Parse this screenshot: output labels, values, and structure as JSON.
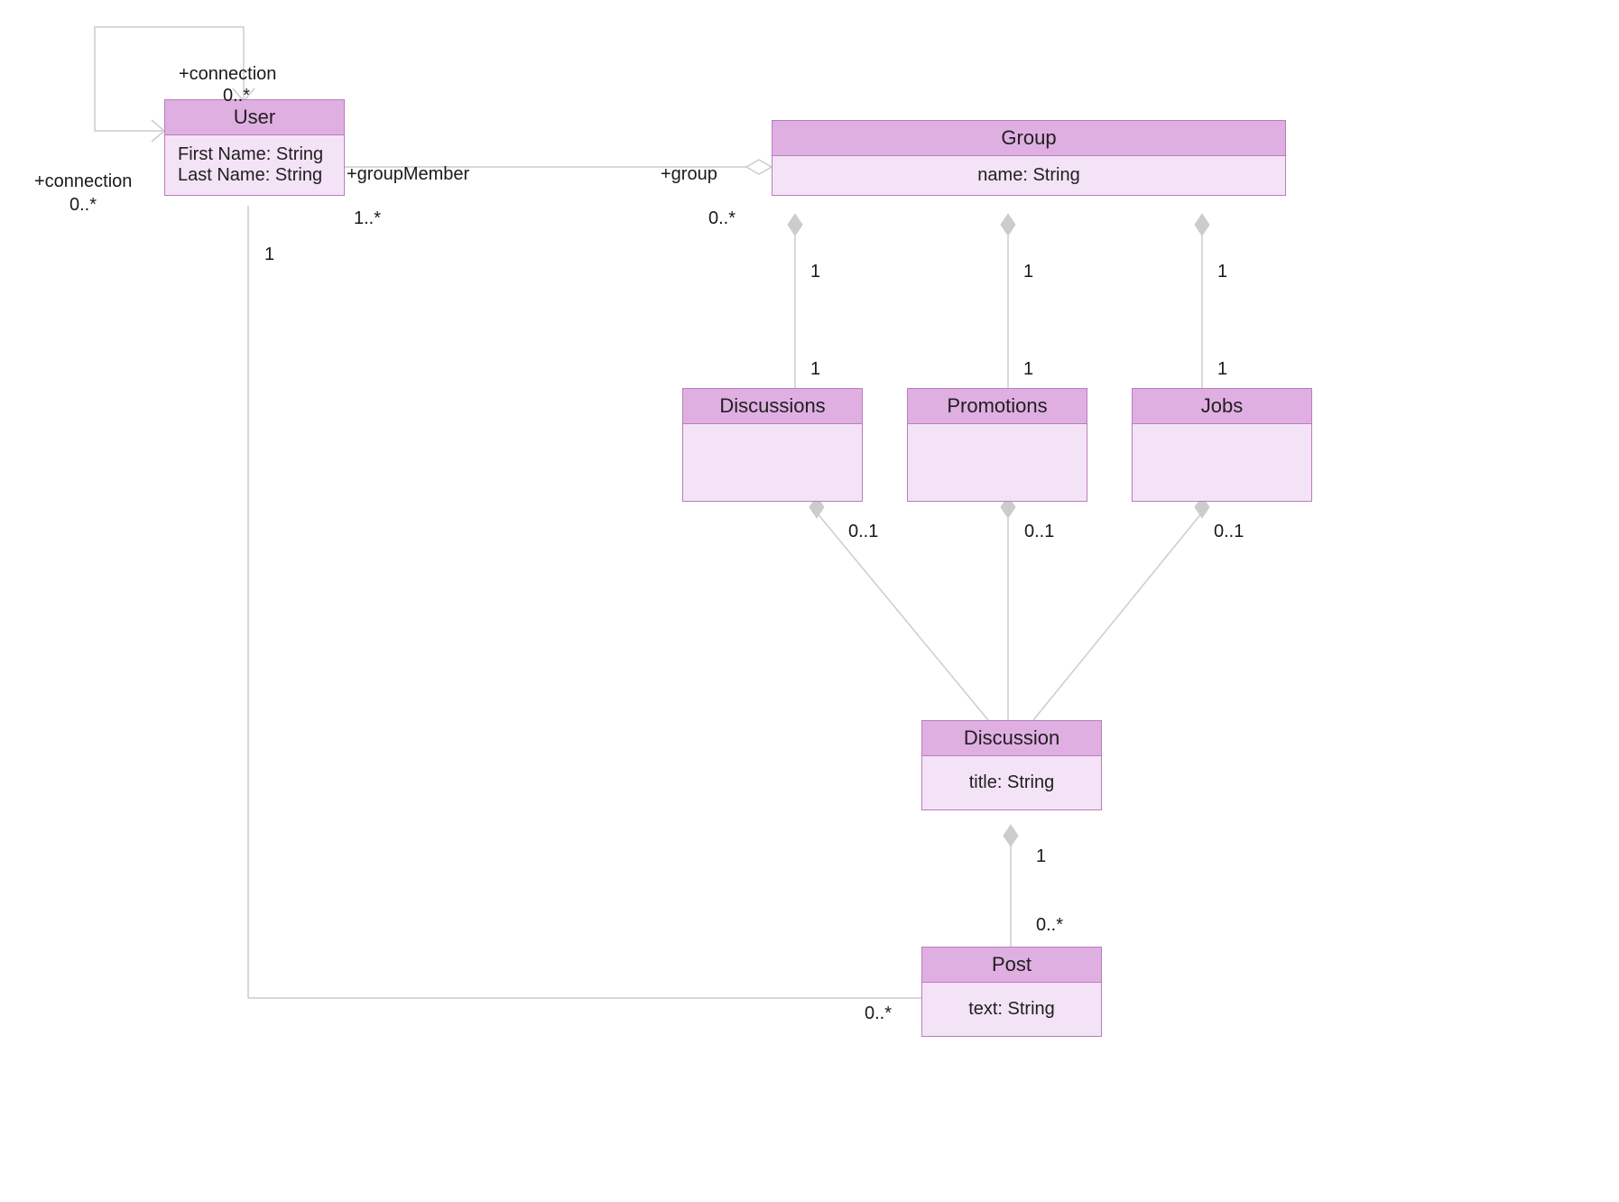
{
  "classes": {
    "user": {
      "name": "User",
      "attrs": [
        "First Name: String",
        "Last Name: String"
      ]
    },
    "group": {
      "name": "Group",
      "attrs": [
        "name: String"
      ]
    },
    "discussions": {
      "name": "Discussions",
      "attrs": []
    },
    "promotions": {
      "name": "Promotions",
      "attrs": []
    },
    "jobs": {
      "name": "Jobs",
      "attrs": []
    },
    "discussion": {
      "name": "Discussion",
      "attrs": [
        "title: String"
      ]
    },
    "post": {
      "name": "Post",
      "attrs": [
        "text: String"
      ]
    }
  },
  "labels": {
    "connection_top": "+connection",
    "connection_top_mult": "0..*",
    "connection_left": "+connection",
    "connection_left_mult": "0..*",
    "groupMember": "+groupMember",
    "groupMember_mult": "1..*",
    "group_role": "+group",
    "group_mult": "0..*",
    "user_one": "1",
    "group_discussions_top": "1",
    "group_promotions_top": "1",
    "group_jobs_top": "1",
    "discussions_top_mult": "1",
    "promotions_top_mult": "1",
    "jobs_top_mult": "1",
    "discussions_bottom_mult": "0..1",
    "promotions_bottom_mult": "0..1",
    "jobs_bottom_mult": "0..1",
    "discussion_one": "1",
    "post_top_mult": "0..*",
    "post_left_mult": "0..*"
  }
}
